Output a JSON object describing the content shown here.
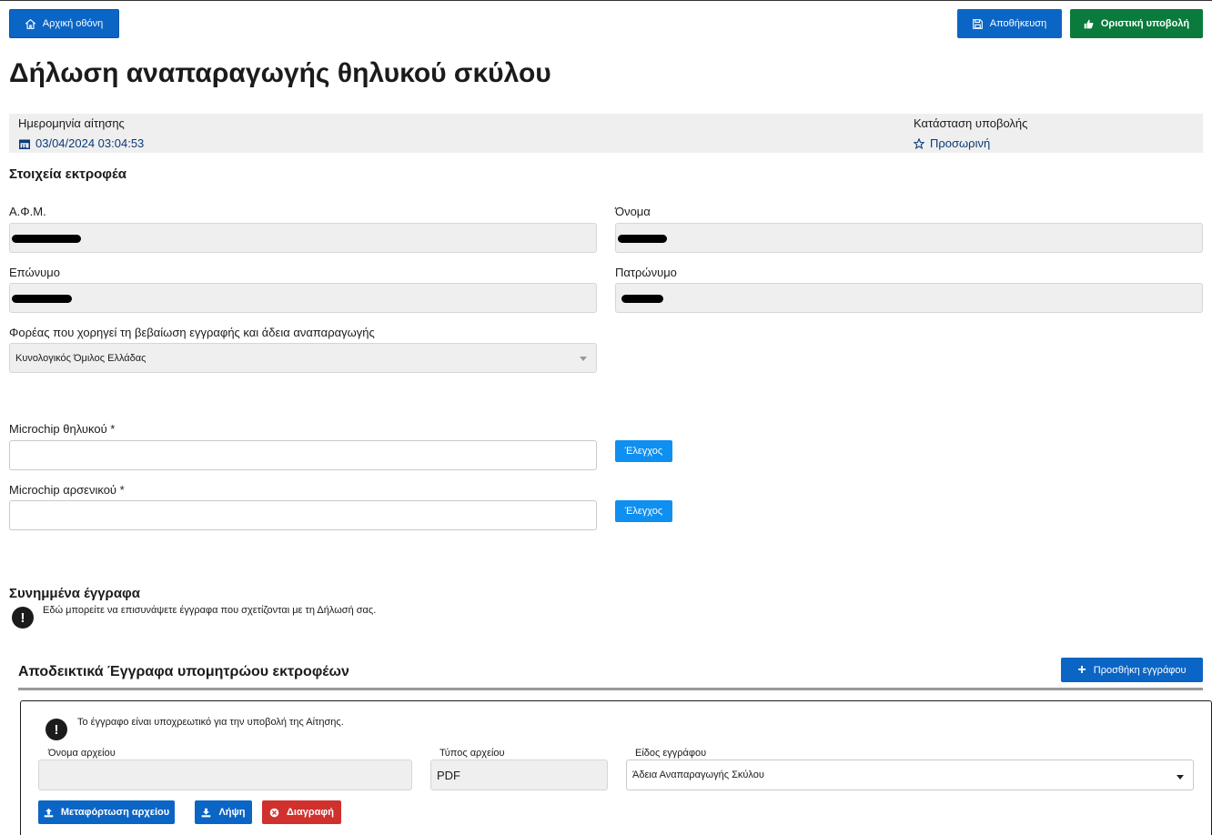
{
  "header": {
    "home_label": "Αρχική οθόνη",
    "save_label": "Αποθήκευση",
    "submit_label": "Οριστική υποβολή"
  },
  "page": {
    "title": "Δήλωση αναπαραγωγής θηλυκού σκύλου"
  },
  "info": {
    "date_label": "Ημερομηνία αίτησης",
    "date_value": "03/04/2024 03:04:53",
    "status_label": "Κατάσταση υποβολής",
    "status_value": "Προσωρινή"
  },
  "breeder": {
    "section_title": "Στοιχεία εκτροφέα",
    "afm_label": "Α.Φ.Μ.",
    "name_label": "Όνομα",
    "surname_label": "Επώνυμο",
    "father_label": "Πατρώνυμο",
    "body_label": "Φορέας που χορηγεί τη βεβαίωση εγγραφής και άδεια αναπαραγωγής",
    "body_value": "Κυνολογικός Όμιλος Ελλάδας"
  },
  "microchip": {
    "female_label": "Microchip θηλυκού *",
    "female_value": "",
    "male_label": "Microchip αρσενικού *",
    "male_value": "",
    "check_label": "Έλεγχος"
  },
  "attachments": {
    "section_title": "Συνημμένα έγγραφα",
    "notice": "Εδώ μπορείτε να επισυνάψετε έγγραφα που σχετίζονται με τη Δήλωσή σας.",
    "group_title": "Αποδεικτικά Έγγραφα υπομητρώου εκτροφέων",
    "add_label": "Προσθήκη εγγράφου",
    "doc": {
      "required_notice": "Το έγγραφο είναι υποχρεωτικό για την υποβολή της Αίτησης.",
      "file_name_label": "Όνομα αρχείου",
      "file_name_value": "",
      "file_type_label": "Τύπος αρχείου",
      "file_type_value": "PDF",
      "doc_kind_label": "Είδος εγγράφου",
      "doc_kind_value": "Άδεια Αναπαραγωγής Σκύλου",
      "upload_label": "Μεταφόρτωση αρχείου",
      "download_label": "Λήψη",
      "delete_label": "Διαγραφή"
    }
  },
  "colors": {
    "primary": "#0b65c5",
    "success": "#0a7a3d",
    "danger": "#d0312d",
    "info": "#0f8ff0"
  }
}
